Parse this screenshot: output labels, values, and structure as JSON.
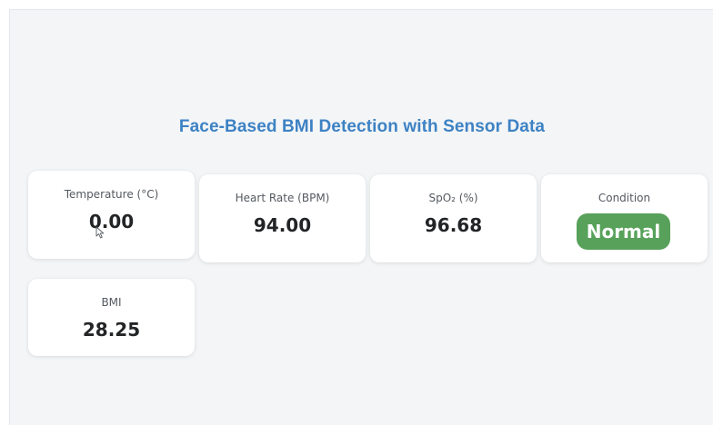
{
  "page": {
    "title": "Face-Based BMI Detection with Sensor Data"
  },
  "cards": {
    "temperature": {
      "label": "Temperature (°C)",
      "value": "0.00"
    },
    "heart_rate": {
      "label": "Heart Rate (BPM)",
      "value": "94.00"
    },
    "spo2": {
      "label": "SpO₂ (%)",
      "value": "96.68"
    },
    "condition": {
      "label": "Condition",
      "value": "Normal"
    },
    "bmi": {
      "label": "BMI",
      "value": "28.25"
    }
  },
  "colors": {
    "title": "#3d82c4",
    "badge_normal": "#57a15a",
    "background": "#f3f5f7",
    "card": "#ffffff"
  },
  "icons": {
    "cursor": "mouse-pointer-icon"
  }
}
